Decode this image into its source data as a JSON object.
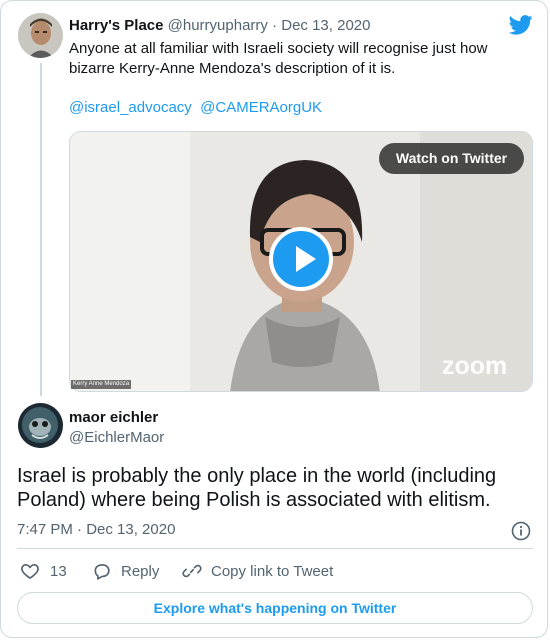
{
  "tweet1": {
    "display_name": "Harry's Place",
    "handle": "@hurryupharry",
    "separator": "·",
    "date": "Dec 13, 2020",
    "text_line1": "Anyone at all familiar with Israeli society will recognise just how",
    "text_line2": "bizarre Kerry-Anne Mendoza's description of it is.",
    "mention1": "@israel_advocacy",
    "mention2": "@CAMERAorgUK",
    "video": {
      "watch_label": "Watch on Twitter",
      "watermark": "zoom",
      "caption": "Kerry Anne Mendoza"
    }
  },
  "tweet2": {
    "display_name": "maor eichler",
    "handle": "@EichlerMaor",
    "text_line1": "Israel is probably the only place in the world (including",
    "text_line2": "Poland) where being Polish is associated with elitism.",
    "timestamp": "7:47 PM · Dec 13, 2020"
  },
  "actions": {
    "like_count": "13",
    "reply_label": "Reply",
    "copy_label": "Copy link to Tweet"
  },
  "explore_label": "Explore what's happening on Twitter",
  "colors": {
    "accent": "#1d9bf0",
    "muted": "#536471",
    "border": "#cfd9de"
  },
  "icons": [
    "twitter-bird-icon",
    "info-icon",
    "heart-icon",
    "reply-icon",
    "link-icon",
    "play-icon"
  ]
}
